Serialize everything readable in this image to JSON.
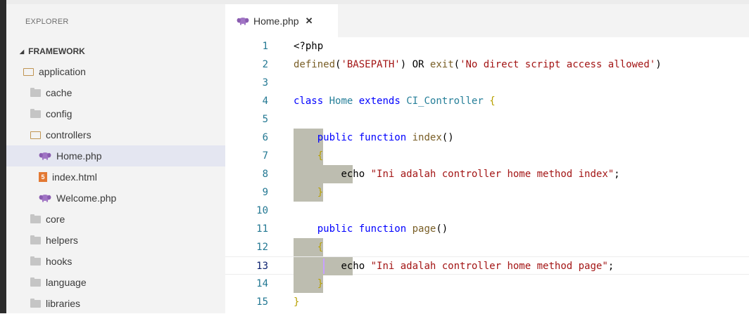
{
  "explorer": {
    "title": "EXPLORER",
    "workspace": "FRAMEWORK",
    "items": [
      {
        "label": "application",
        "type": "folder-open",
        "indent": 1
      },
      {
        "label": "cache",
        "type": "folder",
        "indent": 2
      },
      {
        "label": "config",
        "type": "folder",
        "indent": 2
      },
      {
        "label": "controllers",
        "type": "folder-open",
        "indent": 2
      },
      {
        "label": "Home.php",
        "type": "php",
        "indent": 3,
        "selected": true
      },
      {
        "label": "index.html",
        "type": "html",
        "indent": 3
      },
      {
        "label": "Welcome.php",
        "type": "php",
        "indent": 3
      },
      {
        "label": "core",
        "type": "folder",
        "indent": 2
      },
      {
        "label": "helpers",
        "type": "folder",
        "indent": 2
      },
      {
        "label": "hooks",
        "type": "folder",
        "indent": 2
      },
      {
        "label": "language",
        "type": "folder",
        "indent": 2
      },
      {
        "label": "libraries",
        "type": "folder",
        "indent": 2
      }
    ]
  },
  "tab": {
    "label": "Home.php",
    "close": "✕"
  },
  "editor": {
    "active_line": 13,
    "lines": [
      {
        "n": "1",
        "tokens": [
          {
            "t": "<?php",
            "c": "k-txt"
          }
        ]
      },
      {
        "n": "2",
        "tokens": [
          {
            "t": "defined",
            "c": "k-fn"
          },
          {
            "t": "(",
            "c": "k-txt"
          },
          {
            "t": "'BASEPATH'",
            "c": "k-str"
          },
          {
            "t": ") ",
            "c": "k-txt"
          },
          {
            "t": "OR",
            "c": "k-txt"
          },
          {
            "t": " ",
            "c": "k-txt"
          },
          {
            "t": "exit",
            "c": "k-fn"
          },
          {
            "t": "(",
            "c": "k-txt"
          },
          {
            "t": "'No direct script access allowed'",
            "c": "k-str"
          },
          {
            "t": ")",
            "c": "k-txt"
          }
        ]
      },
      {
        "n": "3",
        "tokens": []
      },
      {
        "n": "4",
        "tokens": [
          {
            "t": "class",
            "c": "k-blue"
          },
          {
            "t": " ",
            "c": "k-txt"
          },
          {
            "t": "Home",
            "c": "k-cls"
          },
          {
            "t": " ",
            "c": "k-txt"
          },
          {
            "t": "extends",
            "c": "k-blue"
          },
          {
            "t": " ",
            "c": "k-txt"
          },
          {
            "t": "CI_Controller",
            "c": "k-cls"
          },
          {
            "t": " ",
            "c": "k-txt"
          },
          {
            "t": "{",
            "c": "k-brace"
          }
        ]
      },
      {
        "n": "5",
        "tokens": []
      },
      {
        "n": "6",
        "indent": 1,
        "tokens": [
          {
            "t": "    ",
            "c": "k-txt"
          },
          {
            "t": "public",
            "c": "k-blue"
          },
          {
            "t": " ",
            "c": "k-txt"
          },
          {
            "t": "function",
            "c": "k-blue"
          },
          {
            "t": " ",
            "c": "k-txt"
          },
          {
            "t": "index",
            "c": "k-fn"
          },
          {
            "t": "()",
            "c": "k-txt"
          }
        ]
      },
      {
        "n": "7",
        "indent": 1,
        "tokens": [
          {
            "t": "    ",
            "c": "k-txt"
          },
          {
            "t": "{",
            "c": "k-brace"
          }
        ]
      },
      {
        "n": "8",
        "indent": 2,
        "tokens": [
          {
            "t": "        ",
            "c": "k-txt"
          },
          {
            "t": "echo",
            "c": "k-txt"
          },
          {
            "t": " ",
            "c": "k-txt"
          },
          {
            "t": "\"Ini adalah controller home method index\"",
            "c": "k-str"
          },
          {
            "t": ";",
            "c": "k-txt"
          }
        ]
      },
      {
        "n": "9",
        "indent": 1,
        "tokens": [
          {
            "t": "    ",
            "c": "k-txt"
          },
          {
            "t": "}",
            "c": "k-brace"
          }
        ]
      },
      {
        "n": "10",
        "tokens": []
      },
      {
        "n": "11",
        "tokens": [
          {
            "t": "    ",
            "c": "k-txt"
          },
          {
            "t": "public",
            "c": "k-blue"
          },
          {
            "t": " ",
            "c": "k-txt"
          },
          {
            "t": "function",
            "c": "k-blue"
          },
          {
            "t": " ",
            "c": "k-txt"
          },
          {
            "t": "page",
            "c": "k-fn"
          },
          {
            "t": "()",
            "c": "k-txt"
          }
        ]
      },
      {
        "n": "12",
        "indent": 1,
        "tokens": [
          {
            "t": "    ",
            "c": "k-txt"
          },
          {
            "t": "{",
            "c": "k-brace"
          }
        ]
      },
      {
        "n": "13",
        "indent": 2,
        "tokens": [
          {
            "t": "        ",
            "c": "k-txt"
          },
          {
            "t": "echo",
            "c": "k-txt"
          },
          {
            "t": " ",
            "c": "k-txt"
          },
          {
            "t": "\"Ini adalah controller home method page\"",
            "c": "k-str"
          },
          {
            "t": ";",
            "c": "k-txt"
          }
        ]
      },
      {
        "n": "14",
        "indent": 1,
        "tokens": [
          {
            "t": "    ",
            "c": "k-txt"
          },
          {
            "t": "}",
            "c": "k-brace"
          }
        ]
      },
      {
        "n": "15",
        "tokens": [
          {
            "t": "}",
            "c": "k-brace"
          }
        ]
      }
    ]
  }
}
